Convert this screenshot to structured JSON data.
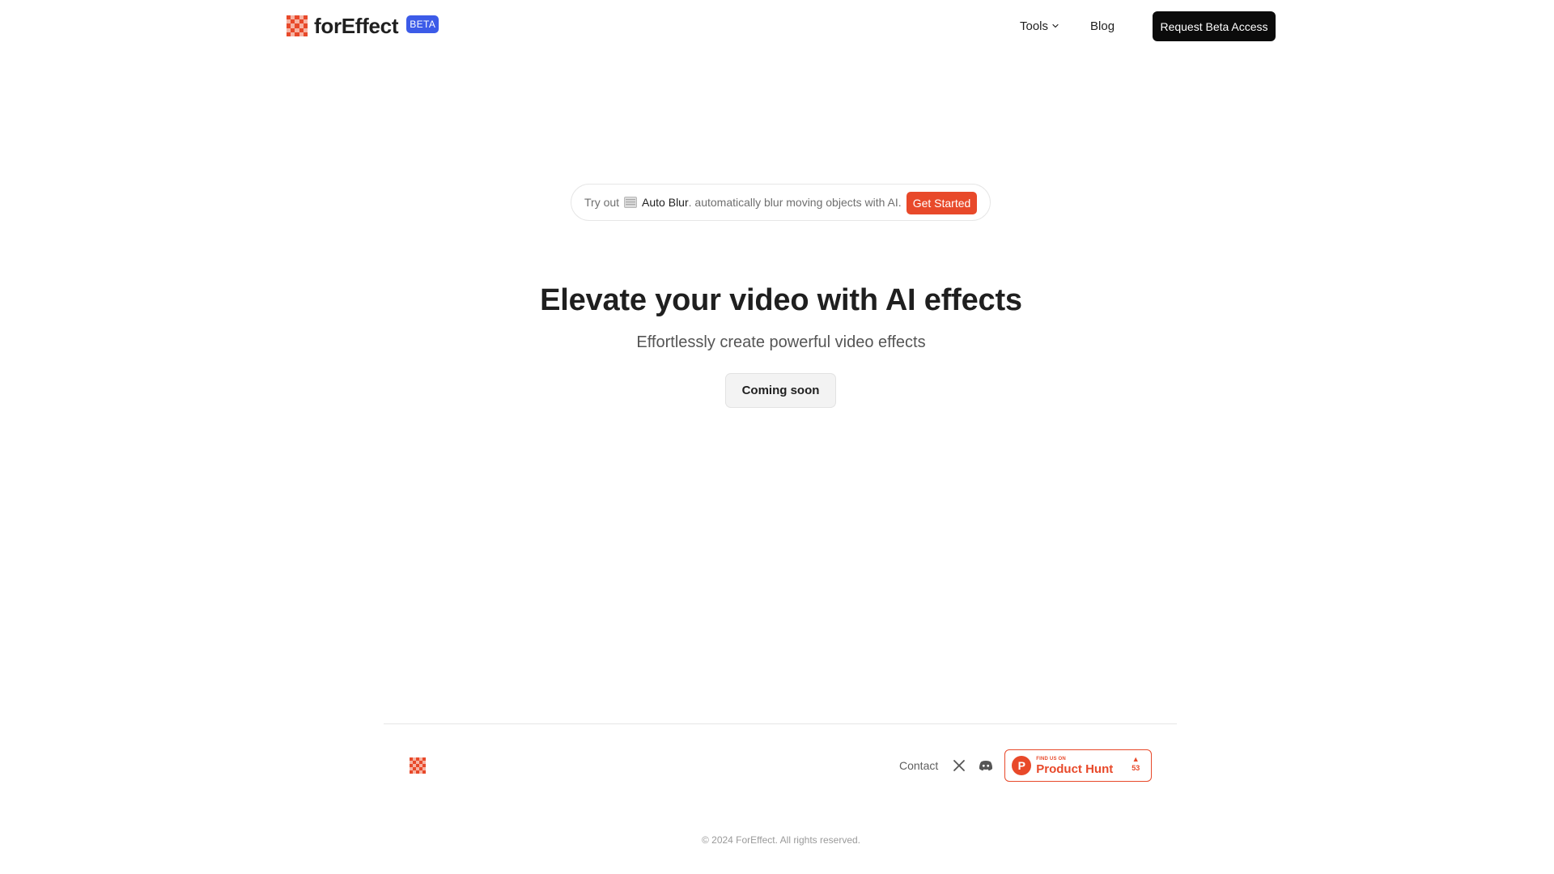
{
  "colors": {
    "brand_orange": "#e8492a",
    "beta_blue": "#3c5be8",
    "cta_black": "#0b0b0b",
    "text_dark": "#1f1f1f",
    "text_muted": "#6f6f6f"
  },
  "header": {
    "brand_name": "forEffect",
    "beta_label": "BETA",
    "nav": {
      "tools_label": "Tools",
      "blog_label": "Blog"
    },
    "cta_label": "Request Beta Access"
  },
  "announcement": {
    "prefix": "Try out",
    "icon": "blur-image-icon",
    "feature_name": "Auto Blur",
    "description": ". automatically blur moving objects with AI.",
    "button_label": "Get Started"
  },
  "hero": {
    "title": "Elevate your video with AI effects",
    "subtitle": "Effortlessly create powerful video effects",
    "button_label": "Coming soon"
  },
  "footer": {
    "contact_label": "Contact",
    "social_icons": [
      "x-icon",
      "discord-icon"
    ],
    "product_hunt": {
      "small_label": "FIND US ON",
      "big_label": "Product Hunt",
      "votes": "53"
    },
    "copyright": "© 2024 ForEffect. All rights reserved."
  }
}
